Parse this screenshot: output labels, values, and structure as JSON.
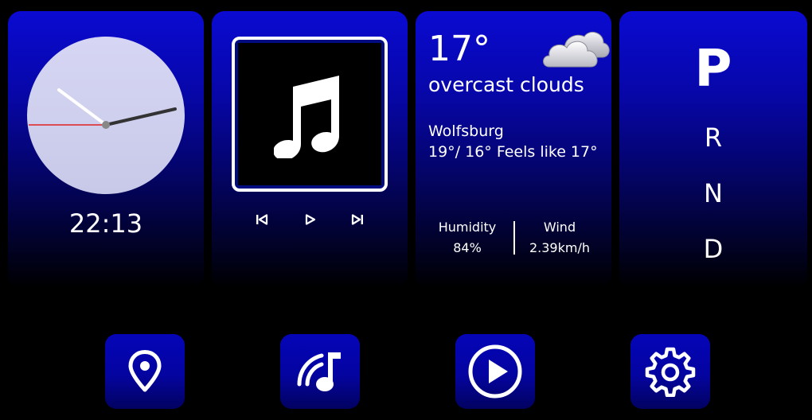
{
  "clock": {
    "time": "22:13"
  },
  "music": {
    "controls": [
      "previous-icon",
      "play-icon",
      "next-icon"
    ]
  },
  "weather": {
    "temperature": "17°",
    "description": "overcast clouds",
    "city": "Wolfsburg",
    "range": "19°/ 16° Feels like 17°",
    "humidity_label": "Humidity",
    "humidity_value": "84%",
    "wind_label": "Wind",
    "wind_value": "2.39km/h",
    "icon": "cloud-icon"
  },
  "gears": {
    "park": "P",
    "reverse": "R",
    "neutral": "N",
    "drive": "D",
    "selected": "P"
  },
  "nav": {
    "items": [
      "map-pin-icon",
      "music-radio-icon",
      "play-circle-icon",
      "gear-settings-icon"
    ]
  },
  "colors": {
    "accent": "#0a0ad2",
    "background": "#000000",
    "second_hand": "#e02020"
  }
}
